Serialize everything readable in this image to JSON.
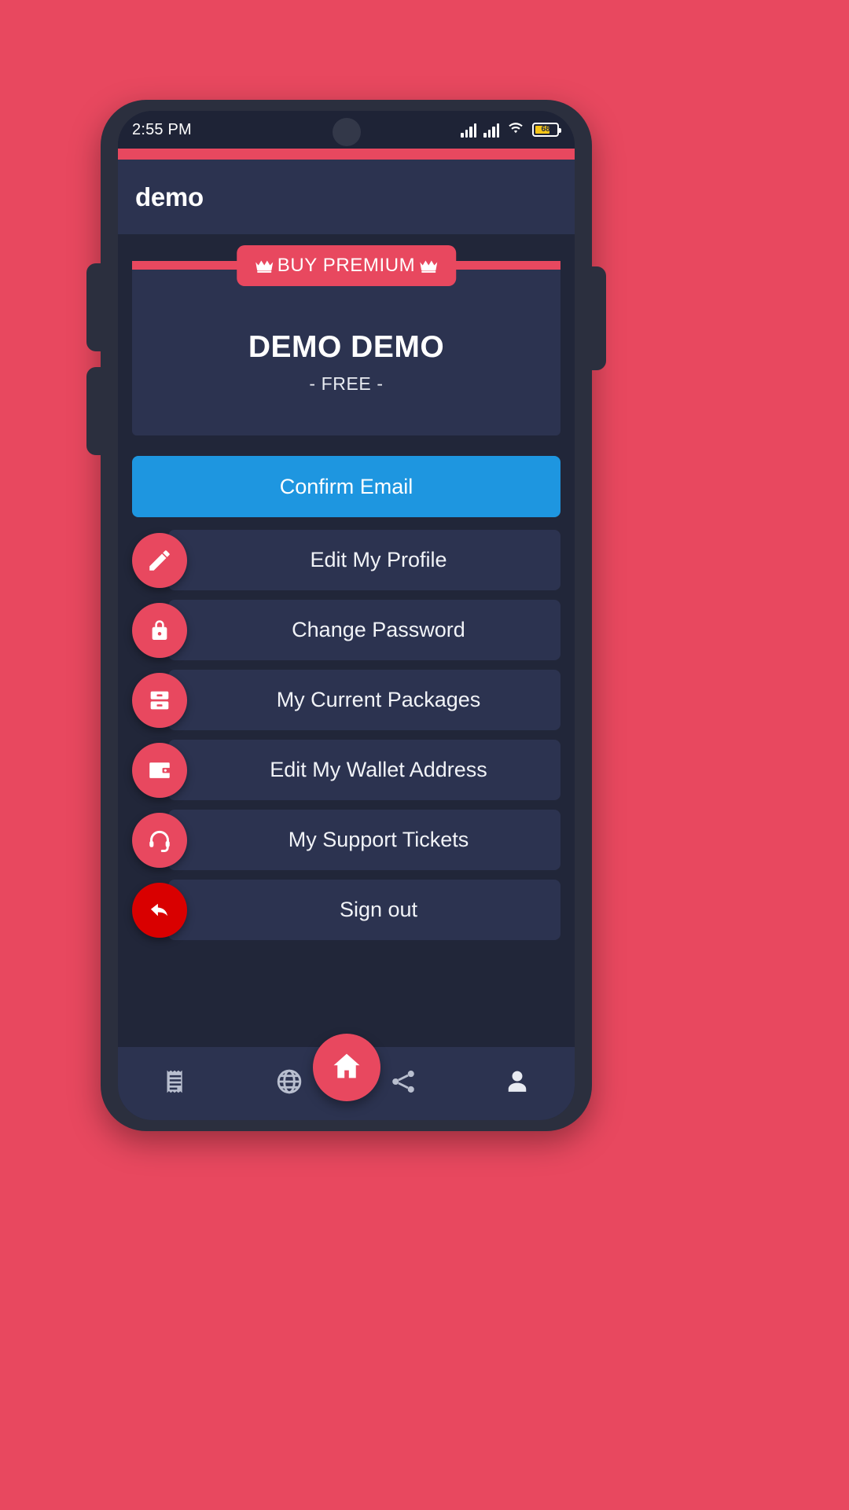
{
  "status_bar": {
    "time": "2:55 PM",
    "battery_level": "68",
    "battery_percent": 68,
    "signal_icon": "signal-bars-icon",
    "wifi_icon": "wifi-icon",
    "battery_icon": "battery-icon"
  },
  "app_bar": {
    "title": "demo"
  },
  "profile": {
    "buy_premium_label": "BUY PREMIUM",
    "crown_icon": "crown-icon",
    "name": "DEMO DEMO",
    "plan": "- FREE -"
  },
  "actions": {
    "confirm_email_label": "Confirm Email"
  },
  "menu": {
    "items": [
      {
        "label": "Edit My Profile",
        "icon": "pencil-icon",
        "style": "default"
      },
      {
        "label": "Change Password",
        "icon": "lock-icon",
        "style": "default"
      },
      {
        "label": "My Current Packages",
        "icon": "archive-icon",
        "style": "default"
      },
      {
        "label": "Edit My Wallet Address",
        "icon": "wallet-icon",
        "style": "default"
      },
      {
        "label": "My Support Tickets",
        "icon": "headset-icon",
        "style": "default"
      },
      {
        "label": "Sign out",
        "icon": "back-arrow-icon",
        "style": "signout"
      }
    ]
  },
  "bottom_nav": {
    "items": [
      {
        "name": "receipt-icon"
      },
      {
        "name": "globe-icon"
      },
      {
        "name": "home-icon"
      },
      {
        "name": "share-icon"
      },
      {
        "name": "person-icon"
      }
    ]
  },
  "colors": {
    "brand_red": "#E8485F",
    "signout_red": "#D90000",
    "primary_blue": "#1E96E0",
    "screen_bg": "#212639",
    "card_bg": "#2c3350",
    "battery_yellow": "#F5C518"
  }
}
